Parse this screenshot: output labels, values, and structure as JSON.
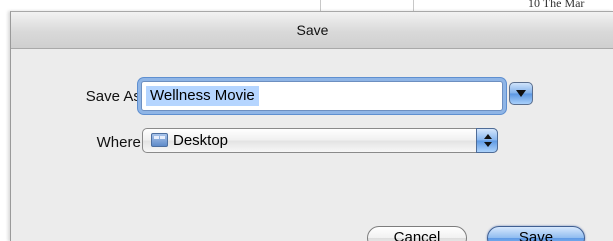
{
  "background": {
    "partial_text": "10 The Mar"
  },
  "dialog": {
    "title": "Save",
    "save_as_label": "Save As:",
    "file_name_value": "Wellness Movie",
    "where_label": "Where:",
    "where_value": "Desktop"
  },
  "buttons": {
    "cancel_label": "Cancel",
    "save_label": "Save"
  },
  "icons": {
    "expand": "disclosure-triangle-down",
    "location": "desktop-folder",
    "popup_arrows": "up-down-chevrons"
  },
  "colors": {
    "accent_blue": "#5f9ae5",
    "selection": "#b5d5ff",
    "sheet_bg": "#ececec"
  }
}
